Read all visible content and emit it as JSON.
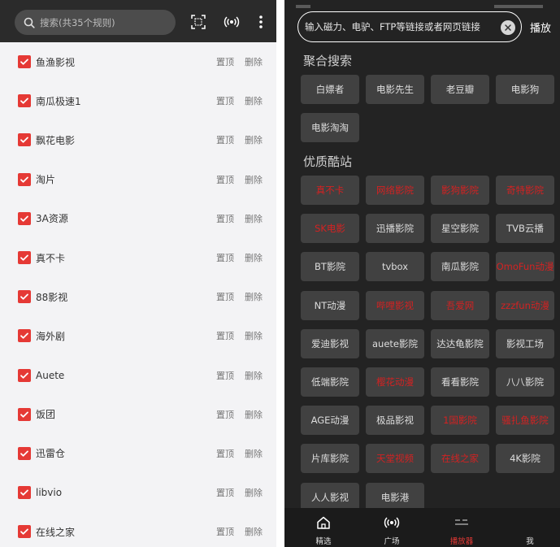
{
  "left": {
    "search_placeholder": "搜索(共35个规则)",
    "rules": [
      {
        "name": "鱼渔影视"
      },
      {
        "name": "南瓜极速1"
      },
      {
        "name": "飘花电影"
      },
      {
        "name": "淘片"
      },
      {
        "name": "3A资源"
      },
      {
        "name": "真不卡"
      },
      {
        "name": "88影视"
      },
      {
        "name": "海外剧"
      },
      {
        "name": "Auete"
      },
      {
        "name": "饭团"
      },
      {
        "name": "迅雷仓"
      },
      {
        "name": "libvio"
      },
      {
        "name": "在线之家"
      }
    ],
    "pin_label": "置顶",
    "delete_label": "删除"
  },
  "right": {
    "url_placeholder": "输入磁力、电驴、FTP等链接或者网页链接",
    "play_label": "播放",
    "section_search": "聚合搜索",
    "section_sites": "优质酷站",
    "search_engines": [
      "白嫖者",
      "电影先生",
      "老豆瓣",
      "电影狗",
      "电影淘淘"
    ],
    "sites": [
      {
        "name": "真不卡",
        "red": true
      },
      {
        "name": "网络影院",
        "red": true
      },
      {
        "name": "影狗影院",
        "red": true
      },
      {
        "name": "奇特影院",
        "red": true
      },
      {
        "name": "SK电影",
        "red": true
      },
      {
        "name": "迅播影院",
        "red": false
      },
      {
        "name": "星空影院",
        "red": false
      },
      {
        "name": "TVB云播",
        "red": false
      },
      {
        "name": "BT影院",
        "red": false
      },
      {
        "name": "tvbox",
        "red": false
      },
      {
        "name": "南瓜影院",
        "red": false
      },
      {
        "name": "OmoFun动漫",
        "red": true
      },
      {
        "name": "NT动漫",
        "red": false
      },
      {
        "name": "哔哩影视",
        "red": true
      },
      {
        "name": "吾爱网",
        "red": true
      },
      {
        "name": "zzzfun动漫",
        "red": true
      },
      {
        "name": "爱迪影视",
        "red": false
      },
      {
        "name": "auete影院",
        "red": false
      },
      {
        "name": "达达龟影院",
        "red": false
      },
      {
        "name": "影视工场",
        "red": false
      },
      {
        "name": "低端影院",
        "red": false
      },
      {
        "name": "樱花动漫",
        "red": true
      },
      {
        "name": "看看影院",
        "red": false
      },
      {
        "name": "八八影院",
        "red": false
      },
      {
        "name": "AGE动漫",
        "red": false
      },
      {
        "name": "极品影视",
        "red": false
      },
      {
        "name": "1国影院",
        "red": true
      },
      {
        "name": "骚扎鱼影院",
        "red": true
      },
      {
        "name": "片库影院",
        "red": false
      },
      {
        "name": "天堂视频",
        "red": true
      },
      {
        "name": "在线之家",
        "red": true
      },
      {
        "name": "4K影院",
        "red": false
      },
      {
        "name": "人人影视",
        "red": false
      },
      {
        "name": "电影港",
        "red": false
      }
    ],
    "nav": [
      {
        "label": "精选",
        "icon": "home-icon",
        "active": false
      },
      {
        "label": "广场",
        "icon": "broadcast-icon",
        "active": false
      },
      {
        "label": "播放器",
        "icon": "player-icon",
        "active": true
      },
      {
        "label": "我",
        "icon": "profile-icon",
        "active": false
      }
    ],
    "colors": {
      "accent": "#e53935",
      "tile_red_text": "#d32222",
      "bg": "#232323"
    }
  }
}
